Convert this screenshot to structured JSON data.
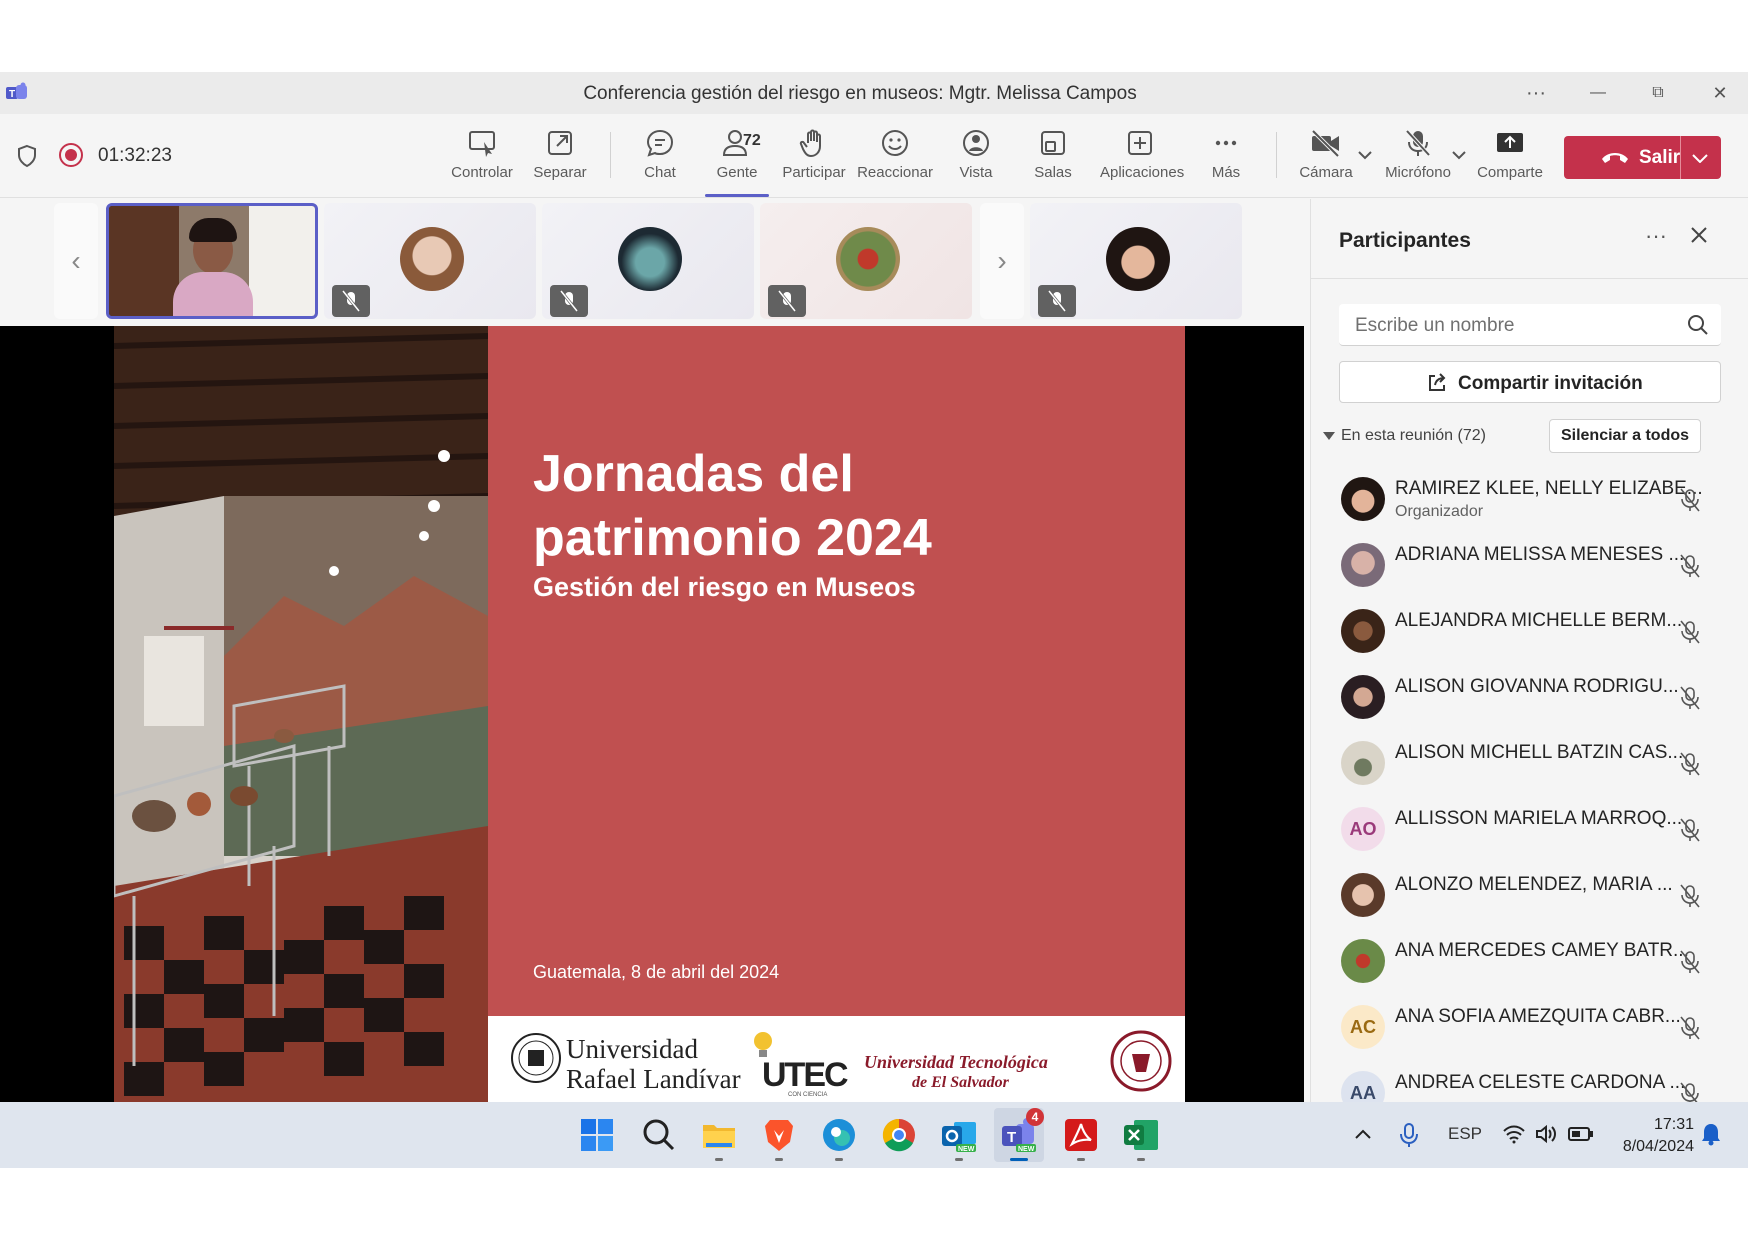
{
  "window": {
    "title": "Conferencia gestión del riesgo en museos: Mgtr. Melissa Campos",
    "more": "···",
    "minimize": "—",
    "maximize": "⧉",
    "close": "✕"
  },
  "toolbar": {
    "timer": "01:32:23",
    "people_count": "72",
    "items": {
      "control": "Controlar",
      "popout": "Separar",
      "chat": "Chat",
      "people": "Gente",
      "raise": "Participar",
      "react": "Reaccionar",
      "view": "Vista",
      "rooms": "Salas",
      "apps": "Aplicaciones",
      "more": "Más",
      "camera": "Cámara",
      "mic": "Micrófono",
      "share": "Comparte"
    },
    "leave": "Salir"
  },
  "slide": {
    "title": "Jornadas del patrimonio 2024",
    "subtitle": "Gestión del riesgo en Museos",
    "date": "Guatemala, 8 de abril del 2024",
    "logos": {
      "url_line1": "Universidad",
      "url_line2": "Rafael Landívar",
      "utec": "UTEC",
      "utec_sub": "CON CIENCIA",
      "ute_sv_line1": "Universidad Tecnológica",
      "ute_sv_line2": "de El Salvador"
    }
  },
  "panel": {
    "title": "Participantes",
    "search_placeholder": "Escribe un nombre",
    "invite": "Compartir invitación",
    "section": "En esta reunión (72)",
    "mute_all": "Silenciar a todos",
    "participants": [
      {
        "name": "RAMIREZ KLEE, NELLY ELIZABE...",
        "role": "Organizador",
        "initials": ""
      },
      {
        "name": "ADRIANA MELISSA MENESES ...",
        "role": "",
        "initials": ""
      },
      {
        "name": "ALEJANDRA MICHELLE BERM...",
        "role": "",
        "initials": ""
      },
      {
        "name": "ALISON GIOVANNA RODRIGU...",
        "role": "",
        "initials": ""
      },
      {
        "name": "ALISON MICHELL BATZIN CAS...",
        "role": "",
        "initials": ""
      },
      {
        "name": "ALLISSON MARIELA MARROQ...",
        "role": "",
        "initials": "AO"
      },
      {
        "name": "ALONZO MELENDEZ, MARIA ...",
        "role": "",
        "initials": ""
      },
      {
        "name": "ANA MERCEDES CAMEY BATR...",
        "role": "",
        "initials": ""
      },
      {
        "name": "ANA SOFIA AMEZQUITA CABR...",
        "role": "",
        "initials": "AC"
      },
      {
        "name": "ANDREA CELESTE CARDONA ...",
        "role": "",
        "initials": "AA"
      }
    ]
  },
  "taskbar": {
    "teams_badge": "4",
    "new_label": "NEW",
    "lang": "ESP",
    "time": "17:31",
    "date": "8/04/2024"
  },
  "colors": {
    "accent": "#5b5fc7",
    "leave": "#c4314b",
    "slide_red": "#c05050"
  }
}
